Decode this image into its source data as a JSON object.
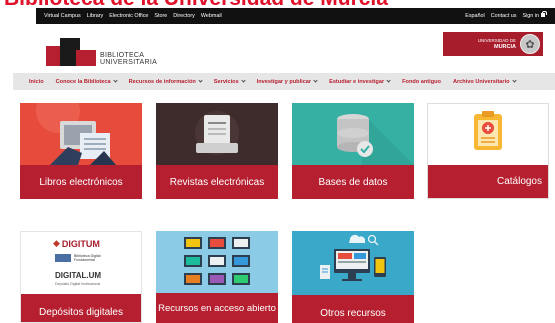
{
  "caption": "Biblioteca de la Universidad de Murcia",
  "topbar": {
    "links": [
      "Virtual Campus",
      "Library",
      "Electronic Office",
      "Store",
      "Directory",
      "Webmail"
    ],
    "right": [
      "Español",
      "Contact us",
      "Sign in"
    ]
  },
  "logo": {
    "line1": "BIBLIOTECA",
    "line2": "UNIVERSITARIA"
  },
  "university": {
    "line1": "UNIVERSIDAD DE",
    "line2": "MURCIA"
  },
  "nav": [
    {
      "label": "Inicio",
      "dropdown": false
    },
    {
      "label": "Conoce la Biblioteca",
      "dropdown": true
    },
    {
      "label": "Recursos de información",
      "dropdown": true
    },
    {
      "label": "Servicios",
      "dropdown": true
    },
    {
      "label": "Investigar y publicar",
      "dropdown": true
    },
    {
      "label": "Estudiar e investigar",
      "dropdown": true
    },
    {
      "label": "Fondo antiguo",
      "dropdown": false
    },
    {
      "label": "Archivo Universitario",
      "dropdown": true
    }
  ],
  "tiles": [
    {
      "label": "Libros electrónicos",
      "icon": "ebook-reader-icon",
      "bg": "#e64b3c"
    },
    {
      "label": "Revistas electrónicas",
      "icon": "journal-icon",
      "bg": "#3e2c2c"
    },
    {
      "label": "Bases de datos",
      "icon": "database-icon",
      "bg": "#37b0a4"
    },
    {
      "label": "Catálogos",
      "icon": "clipboard-icon",
      "bg": "#ffffff"
    },
    {
      "label": "Depósitos digitales",
      "icon": "digitum-logo",
      "bg": "#ffffff",
      "logo_lines": [
        "DIGITUM",
        "Biblioteca Digital Fundamental",
        "DIGITAL.UM",
        "Depósito Digital Institucional"
      ]
    },
    {
      "label": "Recursos en acceso abierto",
      "icon": "screens-icon",
      "bg": "#8ccbe6"
    },
    {
      "label": "Otros recursos",
      "icon": "devices-icon",
      "bg": "#3aa8c8"
    }
  ],
  "colors": {
    "brand": "#b51f2f",
    "caption": "#e0112b",
    "topbar": "#111111",
    "nav_bg": "#e6e6e6"
  }
}
